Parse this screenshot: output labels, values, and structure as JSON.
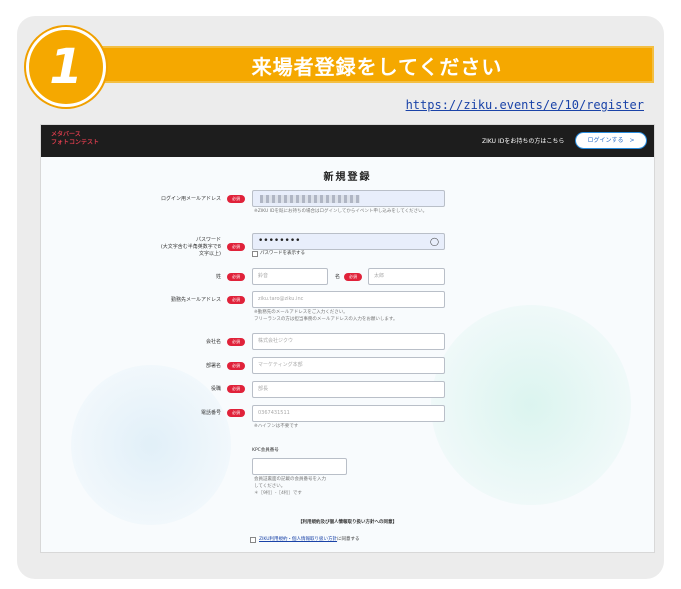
{
  "step": {
    "number": "1",
    "title": "来場者登録をしてください"
  },
  "register_url": "https://ziku.events/e/10/register",
  "site": {
    "logo_line1": "メタバース",
    "logo_line2": "フォトコンテスト",
    "header_link": "ZIKU IDをお持ちの方はこちら",
    "login_button": "ログインする　>"
  },
  "form": {
    "title": "新規登録",
    "required_badge": "必須",
    "login_email": {
      "label": "ログイン用メールアドレス",
      "hint": "※ZIKU IDを既にお持ちの場合はログインしてからイベント申し込みをしてください。"
    },
    "password": {
      "label": "パスワード",
      "sublabel1": "(大文字含む半角英数字で8",
      "sublabel2": "文字以上)",
      "value": "••••••••",
      "show_label": "パスワードを表示する"
    },
    "last_name": {
      "label": "姓",
      "placeholder": "鈴音"
    },
    "first_name": {
      "label": "名",
      "placeholder": "太郎"
    },
    "work_email": {
      "label": "勤務先メールアドレス",
      "placeholder": "ziku.taro@ziku.inc",
      "hint1": "※勤務先のメールアドレスをご入力ください。",
      "hint2": "フリーランスの方は担当事務のメールアドレスの入力をお願いします。"
    },
    "company": {
      "label": "会社名",
      "placeholder": "株式会社ジクウ"
    },
    "department": {
      "label": "部署名",
      "placeholder": "マーケティング本部"
    },
    "position": {
      "label": "役職",
      "placeholder": "部長"
    },
    "phone": {
      "label": "電話番号",
      "placeholder": "0367431511",
      "hint": "※ハイフンは不要です"
    },
    "kpc": {
      "label": "KPC会員番号",
      "hint1": "会員証裏面の記載の会員番号を入力",
      "hint2": "してください。",
      "hint3": "＊［9桁］-［4桁］です"
    },
    "terms_heading": "【利用規約及び個人情報取り扱い方針への同意】",
    "terms_label": "ZIKU利用規約・個人情報取り扱い方針",
    "terms_suffix": "に同意する"
  },
  "colors": {
    "accent": "#f5a800",
    "required": "#e0223a",
    "link": "#1a43a8"
  }
}
